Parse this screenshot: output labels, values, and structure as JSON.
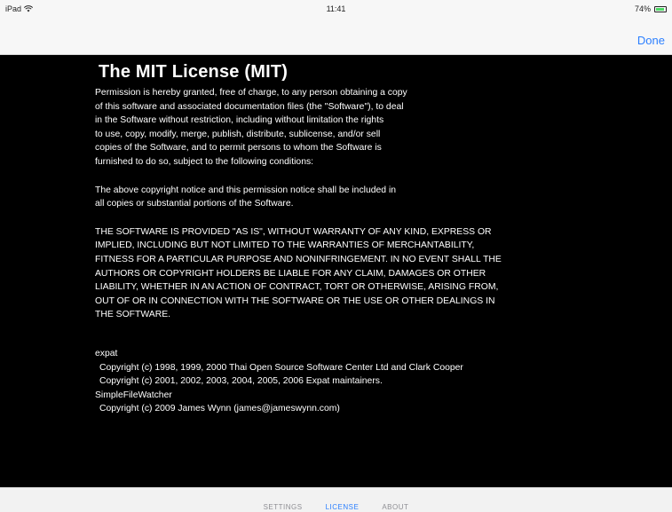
{
  "status_bar": {
    "device": "iPad",
    "time": "11:41",
    "battery": "74%",
    "battery_level": 0.74,
    "battery_color": "#4cd964"
  },
  "nav": {
    "done_label": "Done",
    "accent_color": "#2b7fff"
  },
  "license": {
    "title": "The MIT License (MIT)",
    "paragraph1": "Permission is hereby granted, free of charge, to any person obtaining a copy\nof this software and associated documentation files (the \"Software\"), to deal\nin the Software without restriction, including without limitation the rights\nto use, copy, modify, merge, publish, distribute, sublicense, and/or sell\ncopies of the Software, and to permit persons to whom the Software is\nfurnished to do so, subject to the following conditions:",
    "paragraph2": "The above copyright notice and this permission notice shall be included in\nall copies or substantial portions of the Software.",
    "paragraph3": "THE SOFTWARE IS PROVIDED \"AS IS\", WITHOUT WARRANTY OF ANY KIND, EXPRESS OR\nIMPLIED, INCLUDING BUT NOT LIMITED TO THE WARRANTIES OF MERCHANTABILITY,\nFITNESS FOR A PARTICULAR PURPOSE AND NONINFRINGEMENT. IN NO EVENT SHALL THE\nAUTHORS OR COPYRIGHT HOLDERS BE LIABLE FOR ANY CLAIM, DAMAGES OR OTHER\nLIABILITY, WHETHER IN AN ACTION OF CONTRACT, TORT OR OTHERWISE, ARISING FROM,\nOUT OF OR IN CONNECTION WITH THE SOFTWARE OR THE USE OR OTHER DEALINGS IN\nTHE SOFTWARE."
  },
  "credits": {
    "expat_name": "expat",
    "expat_copyright1": "Copyright (c) 1998, 1999, 2000 Thai Open Source Software Center Ltd and Clark Cooper",
    "expat_copyright2": "Copyright (c) 2001, 2002, 2003, 2004, 2005, 2006 Expat maintainers.",
    "watcher_name": "SimpleFileWatcher",
    "watcher_copyright": "Copyright (c) 2009 James Wynn (james@jameswynn.com)"
  },
  "tabs": [
    {
      "label": "SETTINGS"
    },
    {
      "label": "LICENSE"
    },
    {
      "label": "ABOUT"
    }
  ],
  "active_tab": "LICENSE"
}
